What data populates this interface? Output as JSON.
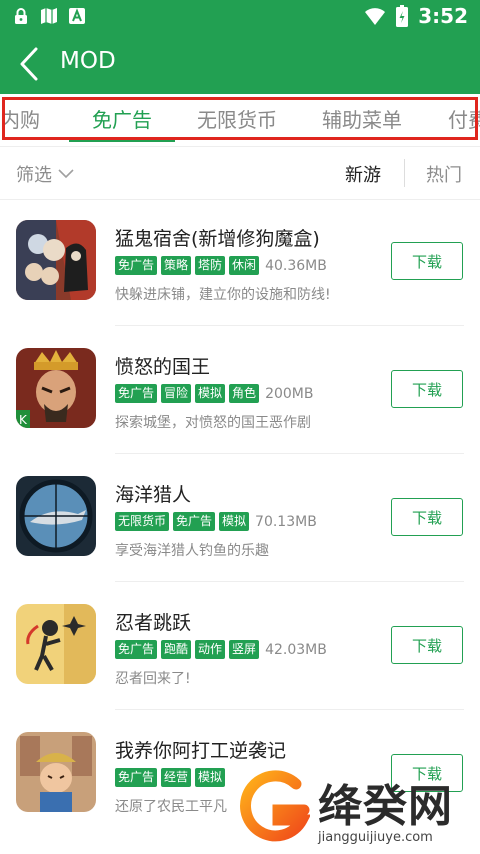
{
  "status_bar": {
    "time": "3:52",
    "left_icons": [
      "lock-icon",
      "map-icon",
      "a-app-icon"
    ],
    "right_icons": [
      "wifi-icon",
      "battery-icon"
    ]
  },
  "header": {
    "title": "MOD",
    "back_icon": "back-arrow-icon"
  },
  "tabs": [
    {
      "label": "免内购",
      "active": false
    },
    {
      "label": "免广告",
      "active": true
    },
    {
      "label": "无限货币",
      "active": false
    },
    {
      "label": "辅助菜单",
      "active": false
    },
    {
      "label": "付费",
      "active": false
    }
  ],
  "filter": {
    "label": "筛选",
    "sort_new": "新游",
    "sort_hot": "热门"
  },
  "apps": [
    {
      "name": "猛鬼宿舍(新增修狗魔盒)",
      "tags": [
        "免广告",
        "策略",
        "塔防",
        "休闲"
      ],
      "size": "40.36MB",
      "desc": "快躲进床铺，建立你的设施和防线!",
      "button": "下载"
    },
    {
      "name": "愤怒的国王",
      "tags": [
        "免广告",
        "冒险",
        "模拟",
        "角色"
      ],
      "size": "200MB",
      "desc": "探索城堡，对愤怒的国王恶作剧",
      "button": "下载"
    },
    {
      "name": "海洋猎人",
      "tags": [
        "无限货币",
        "免广告",
        "模拟"
      ],
      "size": "70.13MB",
      "desc": "享受海洋猎人钓鱼的乐趣",
      "button": "下载"
    },
    {
      "name": "忍者跳跃",
      "tags": [
        "免广告",
        "跑酷",
        "动作",
        "竖屏"
      ],
      "size": "42.03MB",
      "desc": "忍者回来了!",
      "button": "下载"
    },
    {
      "name": "我养你阿打工逆袭记",
      "tags": [
        "免广告",
        "经营",
        "模拟"
      ],
      "size": "",
      "desc": "还原了农民工平凡",
      "button": "下载"
    }
  ],
  "watermark": {
    "title": "绛癸网",
    "url": "jiangguijiuye.com"
  },
  "colors": {
    "brand_green": "#22a052",
    "highlight_red": "#e0261e"
  }
}
